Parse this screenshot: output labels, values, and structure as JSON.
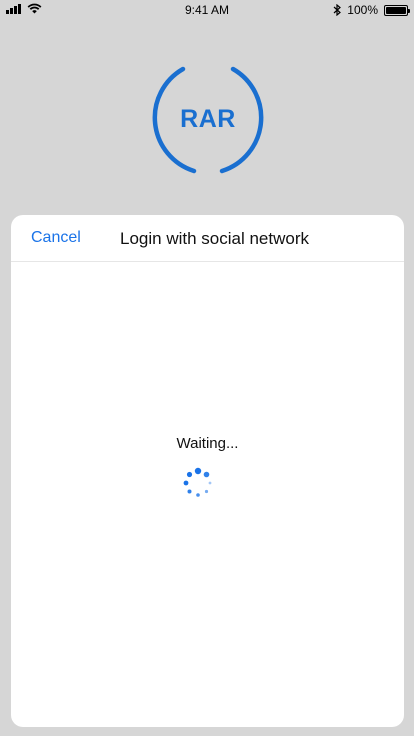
{
  "status_bar": {
    "time": "9:41 AM",
    "battery": "100%",
    "icons": [
      "signal-icon",
      "wifi-icon",
      "bluetooth-icon",
      "battery-icon"
    ]
  },
  "logo": {
    "text": "RAR",
    "color": "#1a6fd0"
  },
  "sheet": {
    "cancel_label": "Cancel",
    "title": "Login with social network",
    "waiting_text": "Waiting..."
  },
  "colors": {
    "background": "#d6d6d6",
    "accent": "#1a73e8",
    "spinner": "#1a73e8"
  }
}
